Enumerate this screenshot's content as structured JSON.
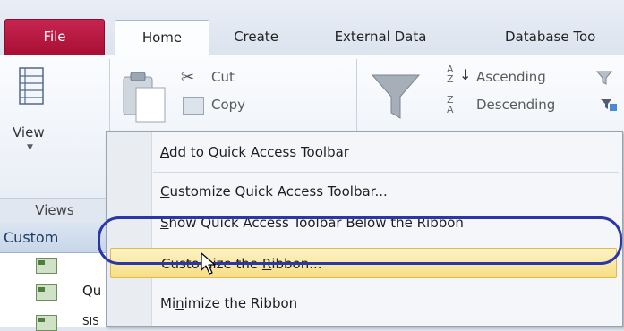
{
  "tabs": {
    "file": "File",
    "home": "Home",
    "create": "Create",
    "external_data": "External Data",
    "database_tools": "Database Too"
  },
  "ribbon": {
    "view_label": "View",
    "views_group": "Views",
    "cut": "Cut",
    "copy": "Copy",
    "ascending": "Ascending",
    "descending": "Descending"
  },
  "nav": {
    "header": "Custom",
    "item1": "Qu",
    "item2": "SIS"
  },
  "menu": {
    "items": [
      {
        "pre": "",
        "key": "A",
        "post": "dd to Quick Access Toolbar"
      },
      {
        "pre": "",
        "key": "C",
        "post": "ustomize Quick Access Toolbar..."
      },
      {
        "pre": "",
        "key": "S",
        "post": "how Quick Access Toolbar Below the Ribbon"
      },
      {
        "pre": "Customize the ",
        "key": "R",
        "post": "ibbon..."
      },
      {
        "pre": "Mi",
        "key": "n",
        "post": "imize the Ribbon"
      }
    ]
  },
  "colors": {
    "file_tab": "#b81a42",
    "menu_highlight": "#f7de84",
    "annotation_ring": "#2937a8"
  }
}
